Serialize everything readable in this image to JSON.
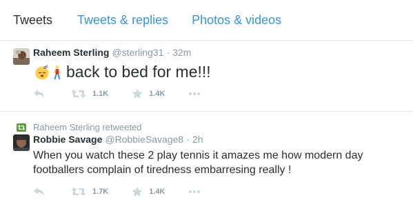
{
  "tabs": [
    {
      "label": "Tweets"
    },
    {
      "label": "Tweets & replies"
    },
    {
      "label": "Photos & videos"
    }
  ],
  "tweets": [
    {
      "fullname": "Raheem Sterling",
      "username": "@sterling31",
      "time": "32m",
      "text": "back to bed for me!!!",
      "emoji": [
        "sleeping-face",
        "walking-person"
      ],
      "retweets": "1.1K",
      "favorites": "1.4K"
    },
    {
      "retweeted_by": "Raheem Sterling retweeted",
      "fullname": "Robbie Savage",
      "username": "@RobbieSavage8",
      "time": "2h",
      "text": "When you watch these 2 play tennis it amazes me how modern day footballers complain of tiredness embarresing really !",
      "retweets": "1.7K",
      "favorites": "1.4K"
    }
  ],
  "colors": {
    "link": "#3b94d9",
    "muted": "#8899a6",
    "text": "#292f33",
    "retweet_green": "#5c9c3c",
    "icon": "#ccd6dd"
  }
}
